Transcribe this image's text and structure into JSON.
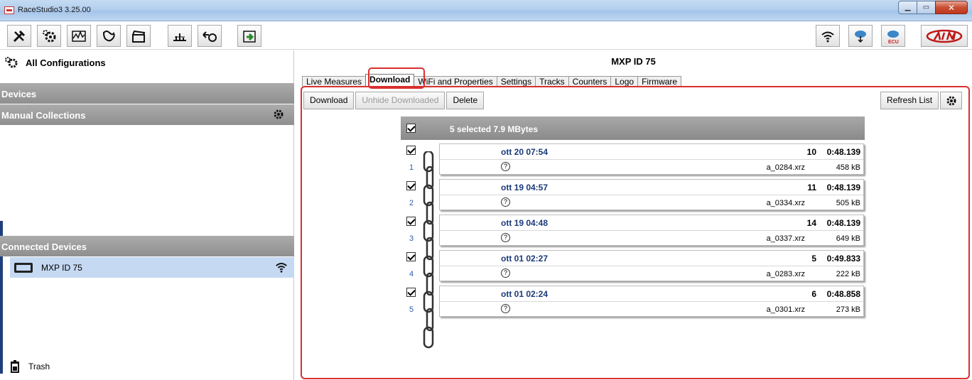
{
  "window": {
    "title": "RaceStudio3 3.25.00"
  },
  "left": {
    "all_configurations": "All Configurations",
    "devices_header": "Devices",
    "manual_collections_header": "Manual Collections",
    "connected_devices_header": "Connected Devices",
    "connected_device_name": "MXP ID 75",
    "trash_label": "Trash"
  },
  "main": {
    "device_title": "MXP ID 75",
    "tabs": [
      "Live Measures",
      "Download",
      "WiFi and Properties",
      "Settings",
      "Tracks",
      "Counters",
      "Logo",
      "Firmware"
    ],
    "active_tab": "Download",
    "actions": {
      "download": "Download",
      "unhide": "Unhide Downloaded",
      "delete": "Delete",
      "refresh": "Refresh List"
    },
    "selection_summary": "5 selected 7.9 MBytes"
  },
  "sessions": [
    {
      "index": "1",
      "date": "ott 20 07:54",
      "laps": "10",
      "best": "0:48.139",
      "file": "a_0284.xrz",
      "size": "458 kB",
      "checked": true
    },
    {
      "index": "2",
      "date": "ott 19 04:57",
      "laps": "11",
      "best": "0:48.139",
      "file": "a_0334.xrz",
      "size": "505 kB",
      "checked": true
    },
    {
      "index": "3",
      "date": "ott 19 04:48",
      "laps": "14",
      "best": "0:48.139",
      "file": "a_0337.xrz",
      "size": "649 kB",
      "checked": true
    },
    {
      "index": "4",
      "date": "ott 01 02:27",
      "laps": "5",
      "best": "0:49.833",
      "file": "a_0283.xrz",
      "size": "222 kB",
      "checked": true
    },
    {
      "index": "5",
      "date": "ott 01 02:24",
      "laps": "6",
      "best": "0:48.858",
      "file": "a_0301.xrz",
      "size": "273 kB",
      "checked": true
    }
  ],
  "colors": {
    "highlight": "#d93030",
    "section_header": "#9c9c9c",
    "selected_device_row": "#c5d9f2",
    "link_blue": "#1a3a7a"
  }
}
